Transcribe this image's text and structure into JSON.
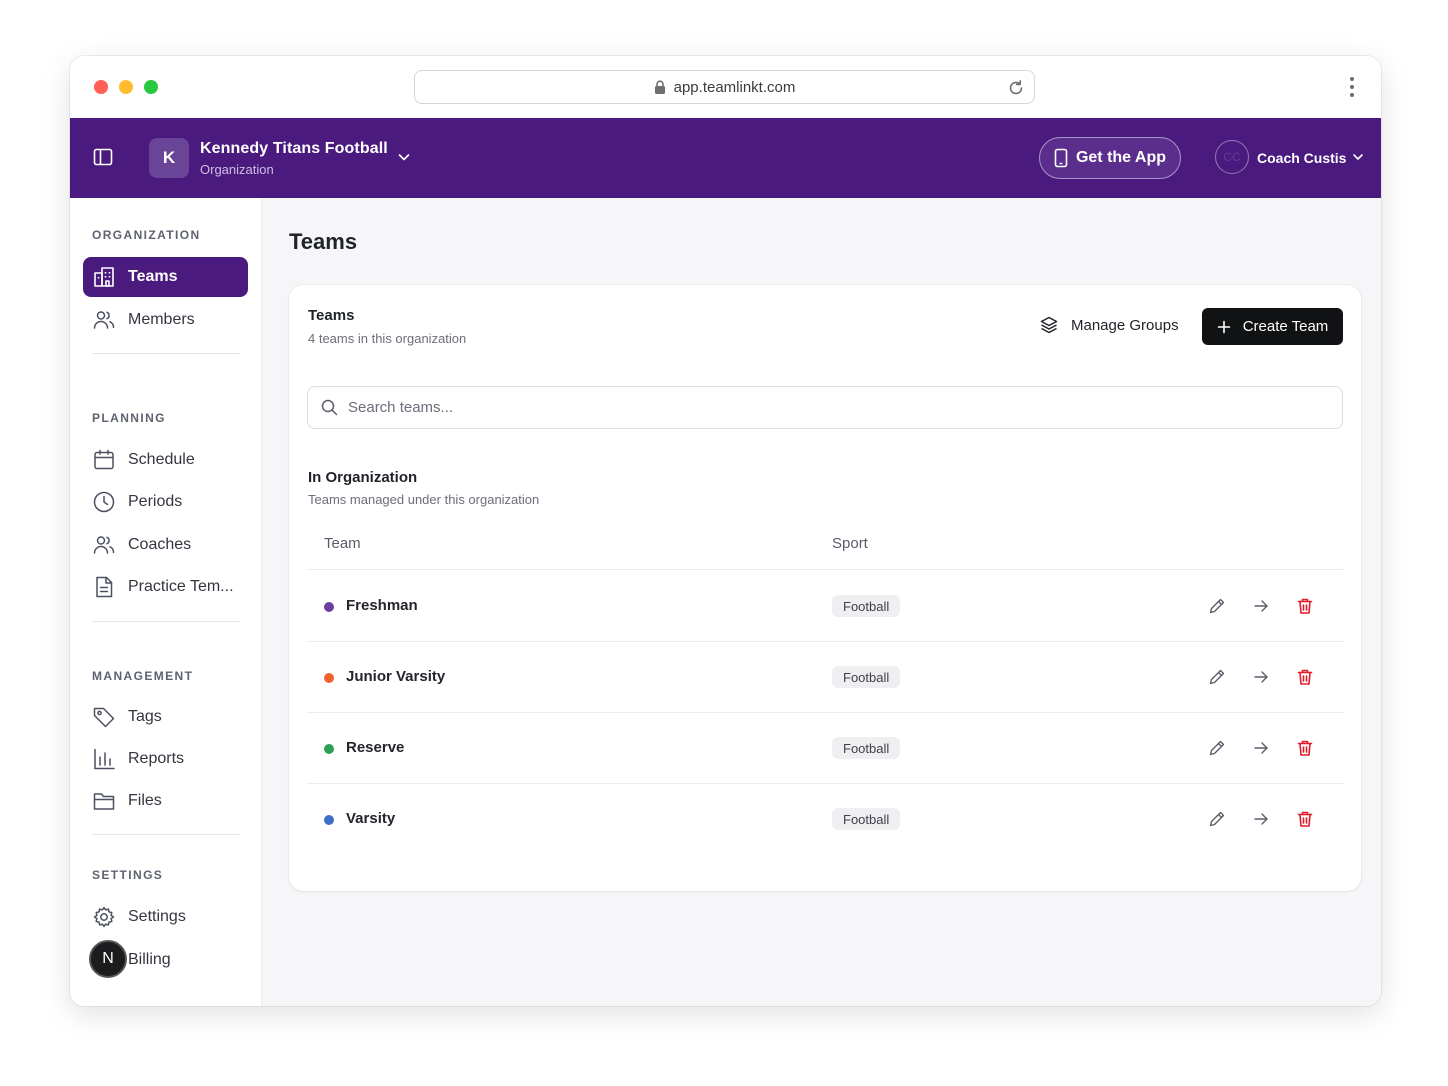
{
  "browser": {
    "url": "app.teamlinkt.com"
  },
  "header": {
    "org_initial": "K",
    "org_name": "Kennedy Titans Football",
    "org_type": "Organization",
    "get_app_label": "Get the App",
    "user_initials": "CC",
    "user_name": "Coach Custis"
  },
  "sidebar": {
    "sections": [
      {
        "title": "ORGANIZATION",
        "items": [
          {
            "label": "Teams",
            "icon": "building-icon",
            "active": true
          },
          {
            "label": "Members",
            "icon": "users-icon"
          }
        ]
      },
      {
        "title": "PLANNING",
        "items": [
          {
            "label": "Schedule",
            "icon": "calendar-icon"
          },
          {
            "label": "Periods",
            "icon": "clock-icon"
          },
          {
            "label": "Coaches",
            "icon": "users-icon"
          },
          {
            "label": "Practice Tem...",
            "icon": "document-icon"
          }
        ]
      },
      {
        "title": "MANAGEMENT",
        "items": [
          {
            "label": "Tags",
            "icon": "tag-icon"
          },
          {
            "label": "Reports",
            "icon": "bar-chart-icon"
          },
          {
            "label": "Files",
            "icon": "folder-icon"
          }
        ]
      },
      {
        "title": "SETTINGS",
        "items": [
          {
            "label": "Settings",
            "icon": "gear-icon"
          },
          {
            "label": "Billing",
            "icon": "credit-card-icon"
          }
        ]
      }
    ],
    "badge_letter": "N"
  },
  "main": {
    "page_title": "Teams",
    "card": {
      "title": "Teams",
      "subtitle": "4 teams in this organization",
      "manage_groups_label": "Manage Groups",
      "create_team_label": "Create Team",
      "search_placeholder": "Search teams...",
      "group_title": "In Organization",
      "group_subtitle": "Teams managed under this organization",
      "columns": [
        "Team",
        "Sport"
      ],
      "rows": [
        {
          "name": "Freshman",
          "sport": "Football",
          "color": "#6b3fa0"
        },
        {
          "name": "Junior Varsity",
          "sport": "Football",
          "color": "#f0622d"
        },
        {
          "name": "Reserve",
          "sport": "Football",
          "color": "#2f9e57"
        },
        {
          "name": "Varsity",
          "sport": "Football",
          "color": "#3f6fc4"
        }
      ]
    }
  },
  "colors": {
    "brand": "#4b1a7f",
    "danger": "#e11d2a",
    "primary_button": "#111214"
  }
}
